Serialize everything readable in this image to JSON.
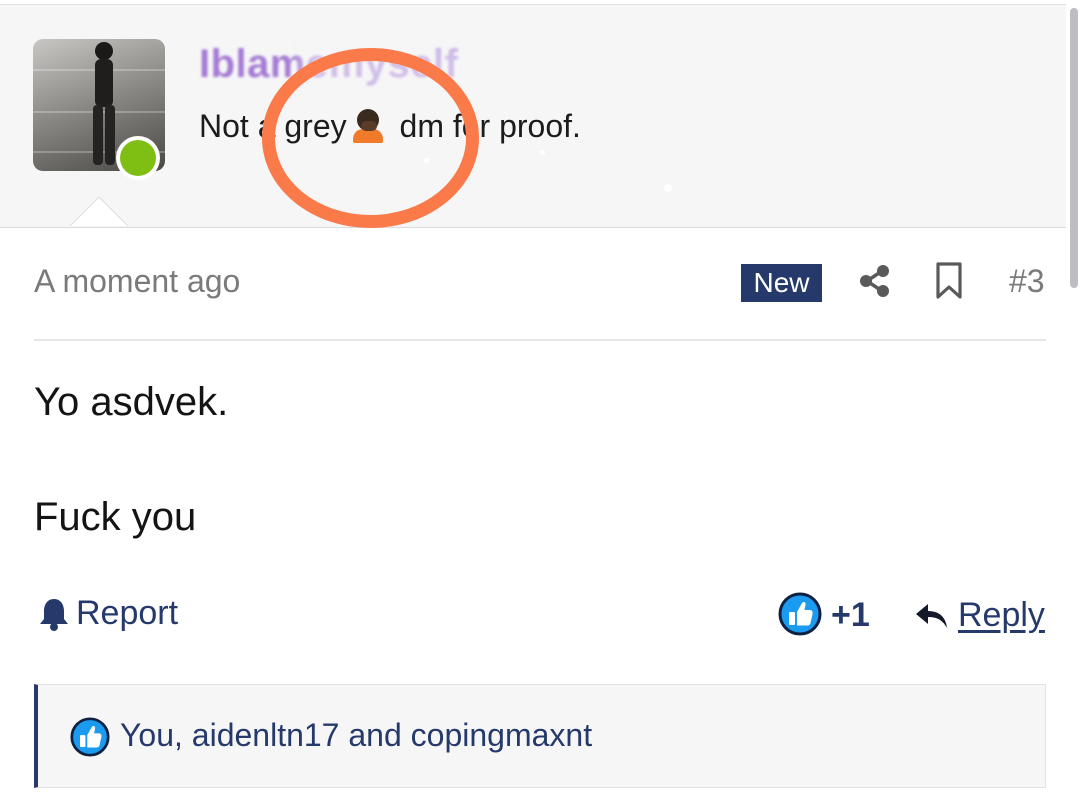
{
  "user": {
    "username": "Iblamemyself",
    "status_text_before_emoji": "Not a grey",
    "status_emoji": "person-facepalming-emoji",
    "status_text_after_emoji": " dm for proof.",
    "online": true
  },
  "post": {
    "timestamp": "A moment ago",
    "badge": "New",
    "number": "#3",
    "body_lines": [
      "Yo asdvek.",
      "Fuck you"
    ]
  },
  "actions": {
    "report_label": "Report",
    "like_count": "+1",
    "reply_label": "Reply"
  },
  "reactions": {
    "text": "You, aidenltn17 and copingmaxnt"
  },
  "colors": {
    "accent": "#253a6b",
    "username": "#a57bd4",
    "online": "#7fbf14",
    "annotation_circle": "#fb7a4a",
    "like_blue": "#1a9bf0"
  },
  "icons": {
    "share": "share-icon",
    "bookmark": "bookmark-icon",
    "report": "bell-icon",
    "like": "thumbs-up-icon",
    "reply": "reply-arrow-icon"
  }
}
